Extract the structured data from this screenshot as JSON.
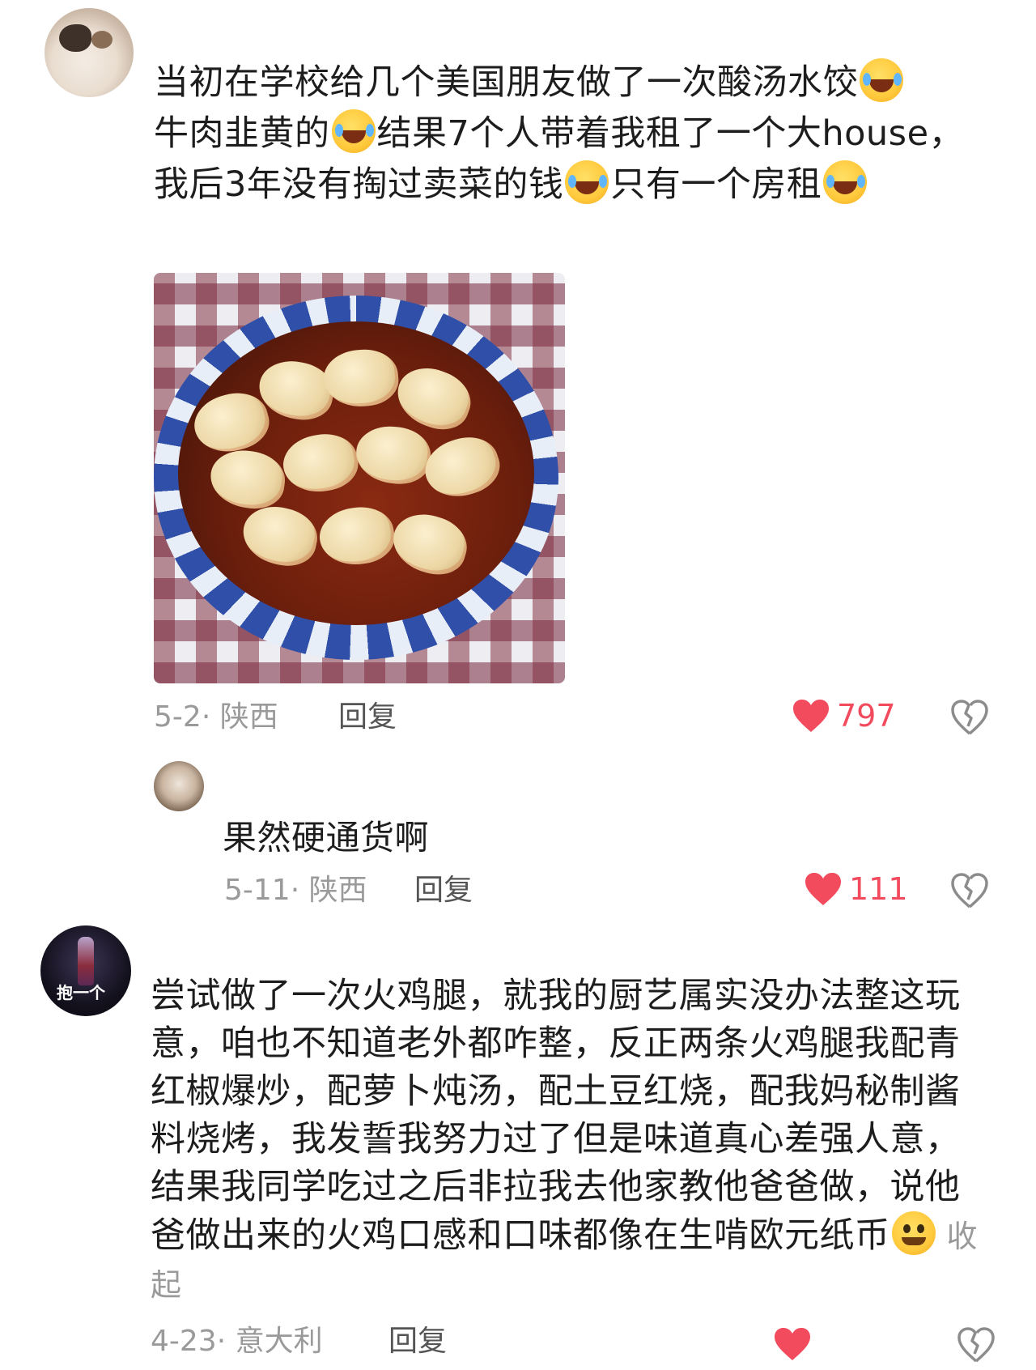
{
  "comments": [
    {
      "text_parts": [
        "当初在学校给几个美国朋友做了一次酸汤水饺",
        "牛肉韭黄的",
        "结果7个人带着我租了一个大house，我后3年没有掏过卖菜的钱",
        "只有一个房租"
      ],
      "date": "5-2",
      "location": "陕西",
      "reply": "回复",
      "likes": "797"
    },
    {
      "text": "果然硬通货啊",
      "date": "5-11",
      "location": "陕西",
      "reply": "回复",
      "likes": "111"
    },
    {
      "avatar_text": "抱一个",
      "text": "尝试做了一次火鸡腿，就我的厨艺属实没办法整这玩意，咱也不知道老外都咋整，反正两条火鸡腿我配青红椒爆炒，配萝卜炖汤，配土豆红烧，配我妈秘制酱料烧烤，我发誓我努力过了但是味道真心差强人意，结果我同学吃过之后非拉我去他家教他爸爸做，说他爸做出来的火鸡口感和口味都像在生啃欧元纸币",
      "collapse": "收起",
      "date": "4-23",
      "location": "意大利",
      "reply": "回复"
    }
  ],
  "colors": {
    "like_red": "#f24b5e",
    "meta_gray": "#9a9a9a"
  },
  "icons": [
    "laughing-crying-emoji",
    "heart-icon",
    "broken-heart-icon",
    "dizzy-smile-emoji"
  ]
}
